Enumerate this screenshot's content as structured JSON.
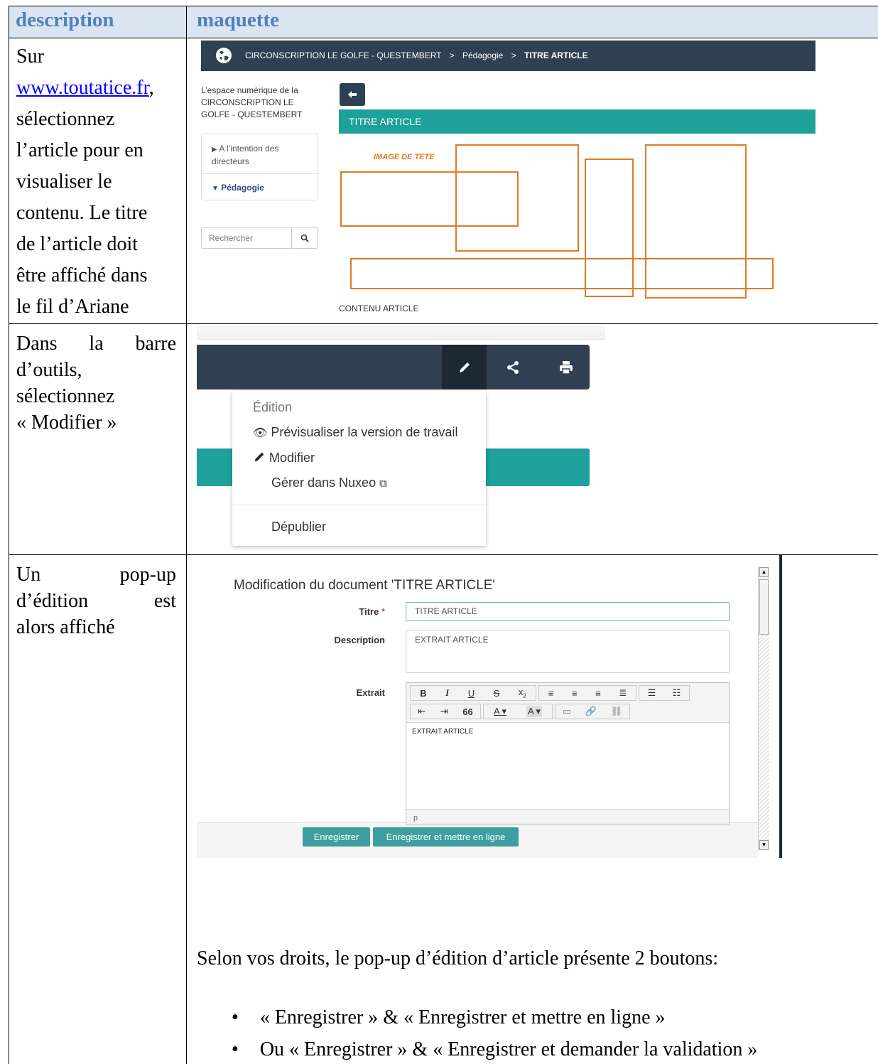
{
  "headers": {
    "description": "description",
    "maquette": "maquette"
  },
  "rows": [
    {
      "description_parts": [
        "Sur",
        "www.toutatice.fr",
        ",",
        "sélectionnez",
        "l’article pour en",
        "visualiser le",
        "contenu. Le titre",
        "de l’article doit",
        "être affiché dans",
        "le fil d’Ariane"
      ],
      "mockup": {
        "breadcrumb": [
          "CIRCONSCRIPTION LE GOLFE - QUESTEMBERT",
          ">",
          "Pédagogie",
          ">",
          "TITRE ARTICLE"
        ],
        "space_title": [
          "L’espace numérique de la",
          "CIRCONSCRIPTION LE",
          "GOLFE - QUESTEMBERT"
        ],
        "menu_items": [
          [
            "A l’intention des",
            "directeurs"
          ],
          [
            "Pédagogie"
          ]
        ],
        "search_placeholder": "Rechercher",
        "article_title": "TITRE ARTICLE",
        "image_label": "IMAGE DE TETE",
        "content_label": "CONTENU ARTICLE"
      }
    },
    {
      "description_lines": [
        "Dans la barre",
        "d’outils,",
        "sélectionnez",
        "« Modifier »"
      ],
      "dropdown": {
        "header": "Édition",
        "items": [
          "Prévisualiser la version de travail",
          "Modifier",
          "Gérer dans Nuxeo",
          "Dépublier"
        ]
      }
    },
    {
      "description_lines": [
        "Un pop-up",
        "d’édition est",
        "alors affiché"
      ],
      "popup": {
        "title": "Modification du document 'TITRE ARTICLE'",
        "fields": {
          "title_label": "Titre",
          "title_required": "*",
          "title_value": "TITRE ARTICLE",
          "description_label": "Description",
          "description_value": "EXTRAIT ARTICLE",
          "extract_label": "Extrait",
          "extract_value": "EXTRAIT ARTICLE",
          "status_path": "p"
        },
        "buttons": [
          "Enregistrer",
          "Enregistrer et mettre en ligne"
        ]
      },
      "note": "Selon vos droits, le pop-up d’édition d’article présente 2 boutons:",
      "bullets": [
        "« Enregistrer » & « Enregistrer et mettre en ligne »",
        "Ou « Enregistrer » & « Enregistrer et demander la validation »"
      ]
    }
  ],
  "colors": {
    "header_bg": "#dbe5f1",
    "header_text": "#4f81bd",
    "navbar": "#2e4052",
    "teal": "#1ea19a",
    "orange": "#e07a27",
    "button_teal": "#3f9ea0"
  }
}
